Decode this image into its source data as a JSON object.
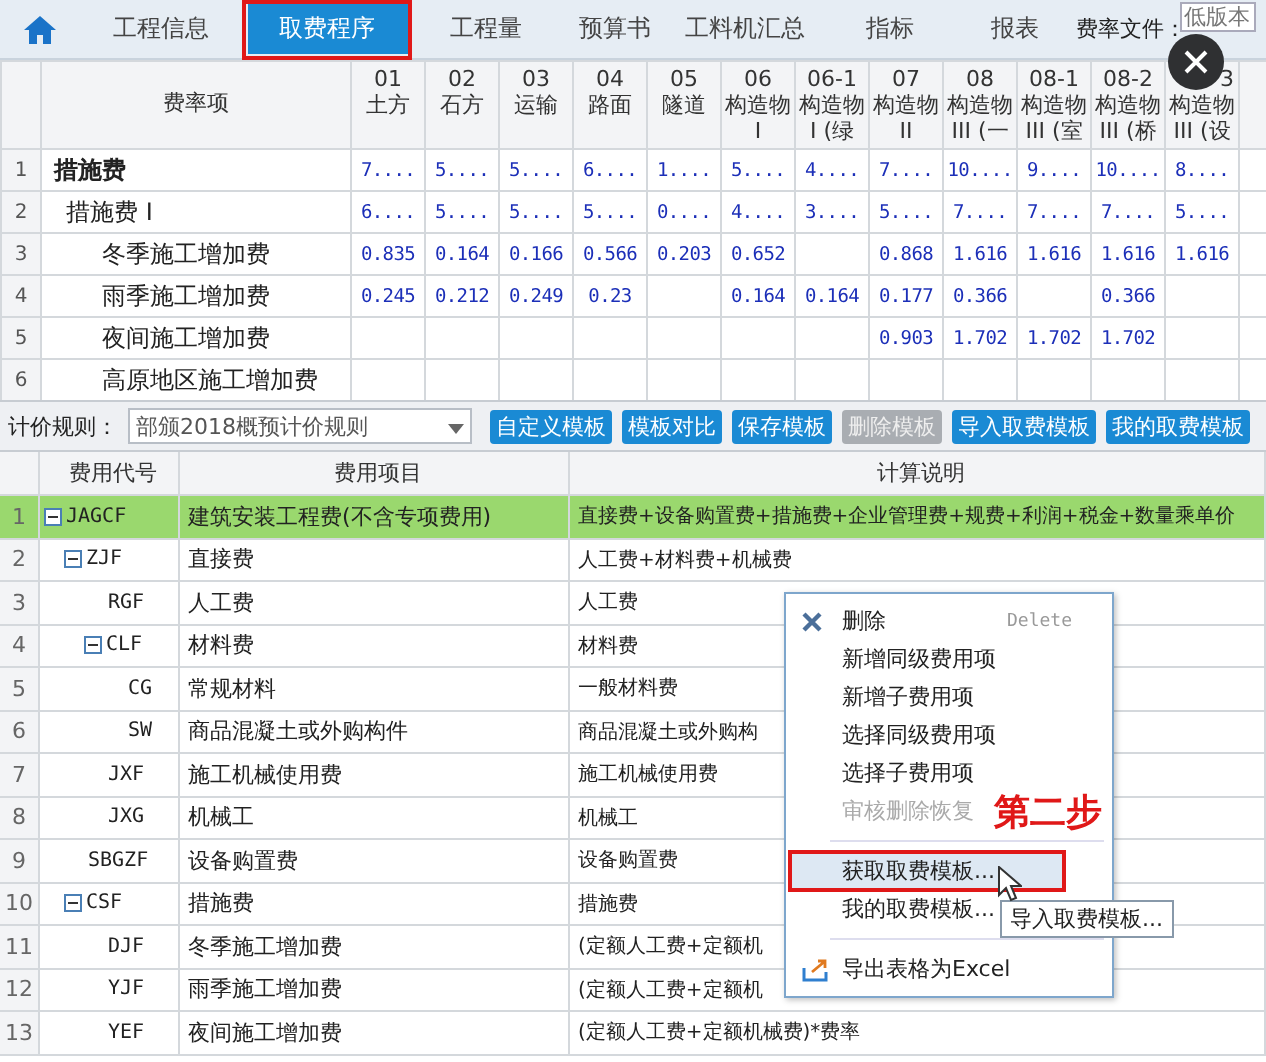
{
  "top_tabs": {
    "items": [
      {
        "label": "工程信息",
        "selected": false,
        "outlined": false
      },
      {
        "label": "取费程序",
        "selected": true,
        "outlined": true
      },
      {
        "label": "工程量",
        "selected": false,
        "outlined": false
      },
      {
        "label": "预算书",
        "selected": false,
        "outlined": false
      },
      {
        "label": "工料机汇总",
        "selected": false,
        "outlined": false
      },
      {
        "label": "指标",
        "selected": false,
        "outlined": false
      },
      {
        "label": "报表",
        "selected": false,
        "outlined": false
      }
    ],
    "fee_file": {
      "label": "费率文件：",
      "value": "低版本"
    }
  },
  "rate_table": {
    "name_column": "费率项",
    "columns": [
      {
        "code": "01",
        "name": "土方"
      },
      {
        "code": "02",
        "name": "石方"
      },
      {
        "code": "03",
        "name": "运输"
      },
      {
        "code": "04",
        "name": "路面"
      },
      {
        "code": "05",
        "name": "隧道"
      },
      {
        "code": "06",
        "name": "构造物 I"
      },
      {
        "code": "06-1",
        "name": "构造物 I (绿"
      },
      {
        "code": "07",
        "name": "构造物 II"
      },
      {
        "code": "08",
        "name": "构造物 III (一"
      },
      {
        "code": "08-1",
        "name": "构造物 III (室"
      },
      {
        "code": "08-2",
        "name": "构造物 III (桥"
      },
      {
        "code": "3",
        "name": "构造物 III (设"
      }
    ],
    "rows": [
      {
        "number": "1",
        "name": "措施费",
        "values": {
          "col_1": "7....",
          "col_2": "5....",
          "col_3": "5....",
          "col_4": "6....",
          "col_5": "1....",
          "col_6": "5....",
          "col_7": "4....",
          "col_8": "7....",
          "col_9": "10....",
          "col_10": "9....",
          "col_11": "10....",
          "col_12": "8...."
        },
        "children": [
          {
            "number": "2",
            "name": "措施费 I",
            "values": {
              "col_1": "6....",
              "col_2": "5....",
              "col_3": "5....",
              "col_4": "5....",
              "col_5": "0....",
              "col_6": "4....",
              "col_7": "3....",
              "col_8": "5....",
              "col_9": "7....",
              "col_10": "7....",
              "col_11": "7....",
              "col_12": "5...."
            },
            "children": [
              {
                "number": "3",
                "name": "冬季施工增加费",
                "values": {
                  "col_1": "0.835",
                  "col_2": "0.164",
                  "col_3": "0.166",
                  "col_4": "0.566",
                  "col_5": "0.203",
                  "col_6": "0.652",
                  "col_8": "0.868",
                  "col_9": "1.616",
                  "col_10": "1.616",
                  "col_11": "1.616",
                  "col_12": "1.616"
                }
              },
              {
                "number": "4",
                "name": "雨季施工增加费",
                "values": {
                  "col_1": "0.245",
                  "col_2": "0.212",
                  "col_3": "0.249",
                  "col_4": "0.23",
                  "col_6": "0.164",
                  "col_7": "0.164",
                  "col_8": "0.177",
                  "col_9": "0.366",
                  "col_11": "0.366"
                }
              },
              {
                "number": "5",
                "name": "夜间施工增加费",
                "values": {
                  "col_8": "0.903",
                  "col_9": "1.702",
                  "col_10": "1.702",
                  "col_11": "1.702"
                }
              },
              {
                "number": "6",
                "name": "高原地区施工增加费"
              }
            ]
          }
        ]
      }
    ]
  },
  "rule_bar": {
    "label": "计价规则：",
    "value": "部颁2018概预计价规则",
    "buttons": [
      {
        "label": "自定义模板",
        "disabled": false
      },
      {
        "label": "模板对比",
        "disabled": false
      },
      {
        "label": "保存模板",
        "disabled": false
      },
      {
        "label": "删除模板",
        "disabled": true
      },
      {
        "label": "导入取费模板",
        "disabled": false
      },
      {
        "label": "我的取费模板",
        "disabled": false
      }
    ]
  },
  "fee_table": {
    "columns": [
      "费用代号",
      "费用项目",
      "计算说明"
    ],
    "rows": [
      {
        "number": "1",
        "code": "JAGCF",
        "name": "建筑安装工程费(不含专项费用)",
        "formula": "直接费+设备购置费+措施费+企业管理费+规费+利润+税金+数量乘单价",
        "selected": true,
        "expanded": true,
        "children": [
          {
            "number": "2",
            "code": "ZJF",
            "name": "直接费",
            "formula": "人工费+材料费+机械费",
            "selected": false,
            "expanded": true,
            "children": [
              {
                "number": "3",
                "code": "RGF",
                "name": "人工费",
                "formula": "人工费",
                "selected": false
              },
              {
                "number": "4",
                "code": "CLF",
                "name": "材料费",
                "formula": "材料费",
                "selected": false,
                "expanded": true,
                "children": [
                  {
                    "number": "5",
                    "code": "CG",
                    "name": "常规材料",
                    "formula": "一般材料费",
                    "selected": false
                  },
                  {
                    "number": "6",
                    "code": "SW",
                    "name": "商品混凝土或外购构件",
                    "formula": "商品混凝土或外购构",
                    "selected": false
                  }
                ]
              },
              {
                "number": "7",
                "code": "JXF",
                "name": "施工机械使用费",
                "formula": "施工机械使用费",
                "selected": false
              },
              {
                "number": "8",
                "code": "JXG",
                "name": "机械工",
                "formula": "机械工",
                "selected": false
              }
            ]
          },
          {
            "number": "9",
            "code": "SBGZF",
            "name": "设备购置费",
            "formula": "设备购置费",
            "selected": false
          },
          {
            "number": "10",
            "code": "CSF",
            "name": "措施费",
            "formula": "措施费",
            "selected": false,
            "expanded": true,
            "children": [
              {
                "number": "11",
                "code": "DJF",
                "name": "冬季施工增加费",
                "formula": "(定额人工费+定额机",
                "selected": false
              },
              {
                "number": "12",
                "code": "YJF",
                "name": "雨季施工增加费",
                "formula": "(定额人工费+定额机",
                "selected": false
              },
              {
                "number": "13",
                "code": "YEF",
                "name": "夜间施工增加费",
                "formula": "(定额人工费+定额机械费)*费率",
                "selected": false
              }
            ]
          }
        ]
      }
    ]
  },
  "context_menu": {
    "items": [
      {
        "kind": "delete",
        "label": "删除",
        "shortcut": "Delete",
        "disabled": false,
        "selected": false,
        "outlined": false
      },
      {
        "kind": "item",
        "label": "新增同级费用项",
        "disabled": false,
        "selected": false,
        "outlined": false
      },
      {
        "kind": "item",
        "label": "新增子费用项",
        "disabled": false,
        "selected": false,
        "outlined": false
      },
      {
        "kind": "item",
        "label": "选择同级费用项",
        "disabled": false,
        "selected": false,
        "outlined": false
      },
      {
        "kind": "item",
        "label": "选择子费用项",
        "disabled": false,
        "selected": false,
        "outlined": false
      },
      {
        "kind": "item",
        "label": "审核删除恢复",
        "disabled": true,
        "selected": false,
        "outlined": false
      },
      {
        "kind": "separator"
      },
      {
        "kind": "item",
        "label": "获取取费模板...",
        "disabled": false,
        "selected": true,
        "outlined": true
      },
      {
        "kind": "item",
        "label": "我的取费模板...",
        "disabled": false,
        "selected": false,
        "outlined": false
      },
      {
        "kind": "separator"
      },
      {
        "kind": "export",
        "label": "导出表格为Excel",
        "disabled": false,
        "selected": false,
        "outlined": false
      }
    ]
  },
  "tooltip": {
    "text": "导入取费模板..."
  },
  "annotation": {
    "text": "第二步"
  }
}
